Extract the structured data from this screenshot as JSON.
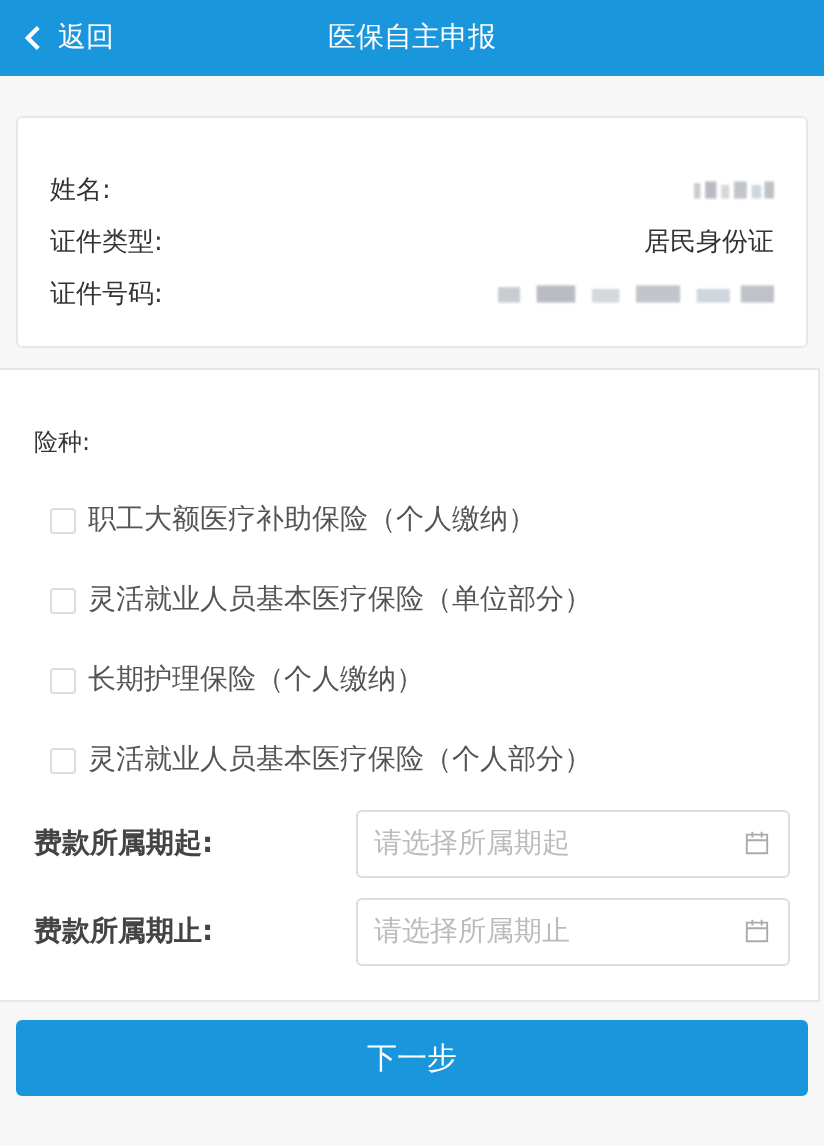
{
  "header": {
    "back": "返回",
    "title": "医保自主申报"
  },
  "person": [
    {
      "label": "姓名:",
      "kind": "blurred"
    },
    {
      "label": "证件类型:",
      "kind": "text",
      "value": "居民身份证"
    },
    {
      "label": "证件号码:",
      "kind": "blurred"
    }
  ],
  "insurance": {
    "label": "险种:",
    "options": [
      {
        "label": "职工大额医疗补助保险（个人缴纳）",
        "checked": false
      },
      {
        "label": "灵活就业人员基本医疗保险（单位部分）",
        "checked": false
      },
      {
        "label": "长期护理保险（个人缴纳）",
        "checked": false
      },
      {
        "label": "灵活就业人员基本医疗保险（个人部分）",
        "checked": false
      }
    ]
  },
  "periods": [
    {
      "label": "费款所属期起:",
      "placeholder": "请选择所属期起"
    },
    {
      "label": "费款所属期止:",
      "placeholder": "请选择所属期止"
    }
  ],
  "next_button": "下一步"
}
